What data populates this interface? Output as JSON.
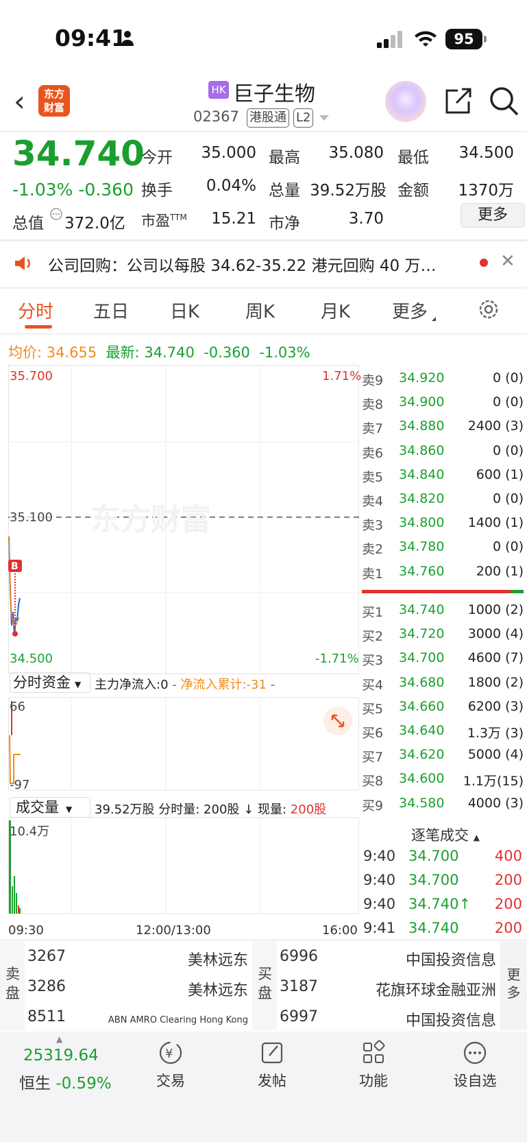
{
  "status_bar": {
    "time": "09:41",
    "battery": "95"
  },
  "header": {
    "logo_text": "东方财富",
    "market_badge": "HK",
    "stock_name": "巨子生物",
    "stock_code": "02367",
    "tag1": "港股通",
    "tag2": "L2"
  },
  "quote": {
    "price": "34.740",
    "change_pct": "-1.03%",
    "change_abs": "-0.360",
    "open_label": "今开",
    "open": "35.000",
    "high_label": "最高",
    "high": "35.080",
    "low_label": "最低",
    "low": "34.500",
    "turnover_label": "换手",
    "turnover": "0.04%",
    "volume_label": "总量",
    "volume": "39.52万股",
    "amount_label": "金额",
    "amount": "1370万",
    "mktcap_label": "总值",
    "mktcap": "372.0亿",
    "pe_label": "市盈",
    "pe_sup": "TTM",
    "pe": "15.21",
    "pb_label": "市净",
    "pb": "3.70",
    "more": "更多"
  },
  "notice": {
    "text": "公司回购：公司以每股 34.62-35.22 港元回购 40 万…"
  },
  "tabs": [
    "分时",
    "五日",
    "日K",
    "周K",
    "月K",
    "更多"
  ],
  "summary": {
    "avg_label": "均价:",
    "avg": "34.655",
    "last_label": "最新:",
    "last": "34.740",
    "chg": "-0.360",
    "pct": "-1.03%"
  },
  "chart": {
    "top_price": "35.700",
    "top_pct": "1.71%",
    "mid_price": "35.100",
    "bottom_price": "34.500",
    "bottom_pct": "-1.71%",
    "watermark": "东方财富",
    "marker": "B"
  },
  "fund_flow": {
    "selector": "分时资金",
    "main_net": "主力净流入:0",
    "sep": "-",
    "cum": "净流入累计:-31",
    "top": "66",
    "bottom": "-97"
  },
  "volume_panel": {
    "selector": "成交量",
    "total": "39.52万股",
    "minute": "分时量: 200股",
    "current_label": "现量:",
    "current": "200股",
    "max": "10.4万"
  },
  "time_axis": [
    "09:30",
    "12:00/13:00",
    "16:00"
  ],
  "order_book": {
    "asks": [
      {
        "k": "卖9",
        "p": "34.920",
        "q": "0 (0)"
      },
      {
        "k": "卖8",
        "p": "34.900",
        "q": "0 (0)"
      },
      {
        "k": "卖7",
        "p": "34.880",
        "q": "2400 (3)"
      },
      {
        "k": "卖6",
        "p": "34.860",
        "q": "0 (0)"
      },
      {
        "k": "卖5",
        "p": "34.840",
        "q": "600 (1)"
      },
      {
        "k": "卖4",
        "p": "34.820",
        "q": "0 (0)"
      },
      {
        "k": "卖3",
        "p": "34.800",
        "q": "1400 (1)"
      },
      {
        "k": "卖2",
        "p": "34.780",
        "q": "0 (0)"
      },
      {
        "k": "卖1",
        "p": "34.760",
        "q": "200 (1)"
      }
    ],
    "bids": [
      {
        "k": "买1",
        "p": "34.740",
        "q": "1000 (2)"
      },
      {
        "k": "买2",
        "p": "34.720",
        "q": "3000 (4)"
      },
      {
        "k": "买3",
        "p": "34.700",
        "q": "4600 (7)"
      },
      {
        "k": "买4",
        "p": "34.680",
        "q": "1800 (2)"
      },
      {
        "k": "买5",
        "p": "34.660",
        "q": "6200 (3)"
      },
      {
        "k": "买6",
        "p": "34.640",
        "q": "1.3万 (3)"
      },
      {
        "k": "买7",
        "p": "34.620",
        "q": "5000 (4)"
      },
      {
        "k": "买8",
        "p": "34.600",
        "q": "1.1万(15)"
      },
      {
        "k": "买9",
        "p": "34.580",
        "q": "4000 (3)"
      }
    ]
  },
  "ticks": {
    "title": "逐笔成交",
    "rows": [
      {
        "t": "9:40",
        "p": "34.700",
        "v": "400"
      },
      {
        "t": "9:40",
        "p": "34.700",
        "v": "200"
      },
      {
        "t": "9:40",
        "p": "34.740↑",
        "v": "200"
      },
      {
        "t": "9:41",
        "p": "34.740",
        "v": "200"
      }
    ]
  },
  "brokers": {
    "sell_label": "卖盘",
    "buy_label": "买盘",
    "more": "更多",
    "sell": [
      {
        "id": "3267",
        "name": "美林远东"
      },
      {
        "id": "3286",
        "name": "美林远东"
      },
      {
        "id": "8511",
        "name": "ABN AMRO Clearing Hong Kong"
      }
    ],
    "buy": [
      {
        "id": "6996",
        "name": "中国投资信息"
      },
      {
        "id": "3187",
        "name": "花旗环球金融亚洲"
      },
      {
        "id": "6997",
        "name": "中国投资信息"
      }
    ]
  },
  "bottom_nav": {
    "index_value": "25319.64",
    "index_name": "恒生",
    "index_chg": "-0.59%",
    "items": [
      "交易",
      "发帖",
      "功能",
      "设自选"
    ]
  }
}
